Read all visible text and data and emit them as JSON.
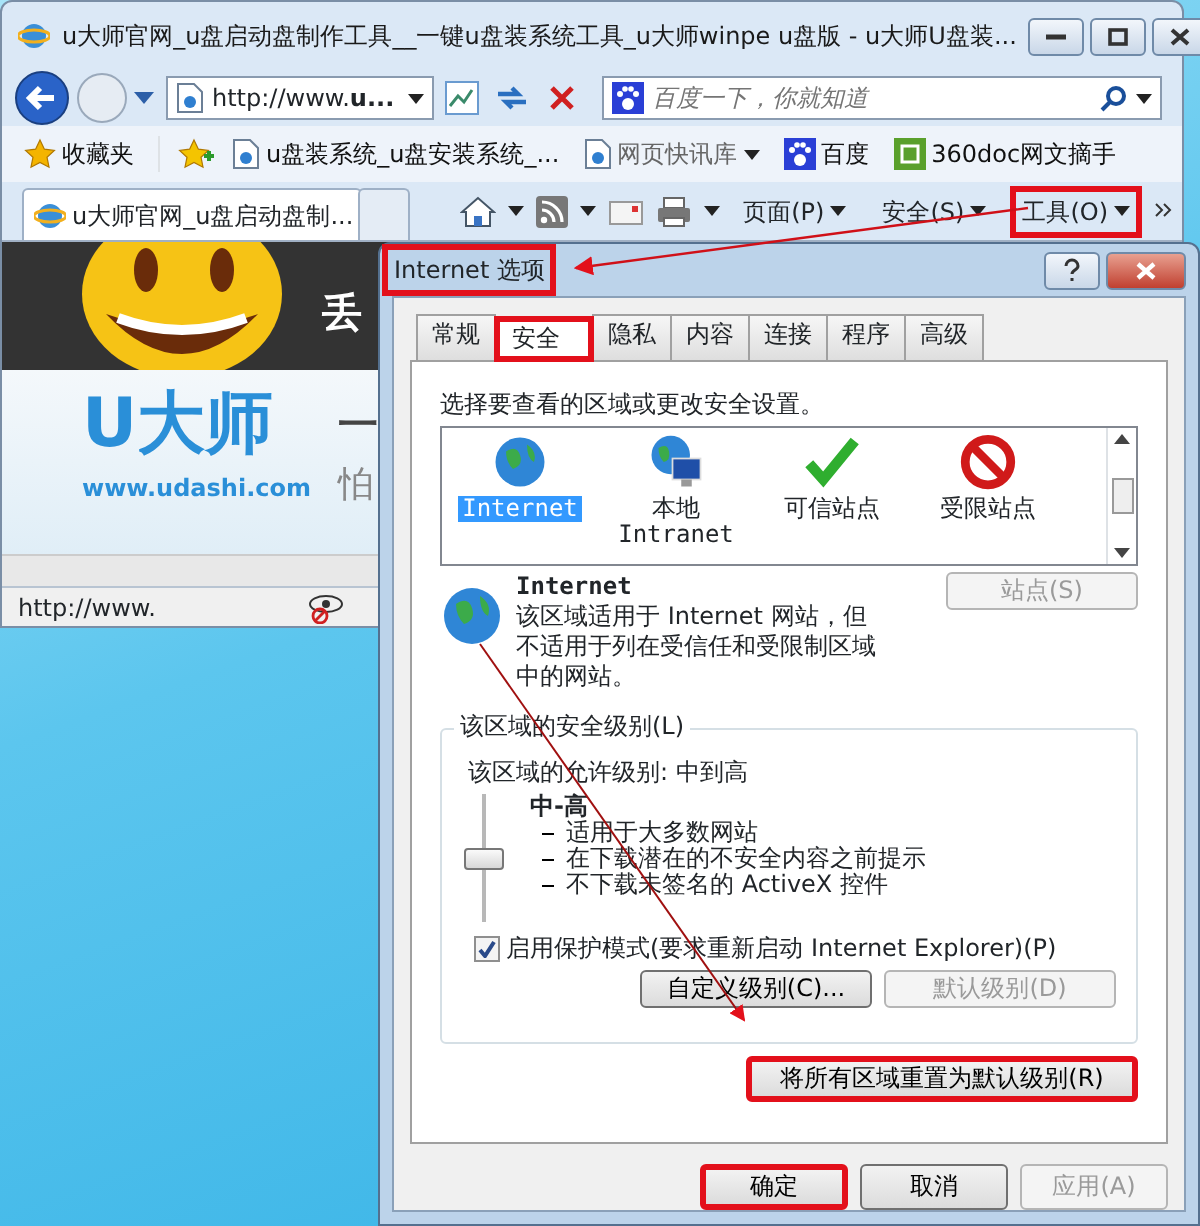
{
  "browser": {
    "title": "u大师官网_u盘启动盘制作工具__一键u盘装系统工具_u大师winpe u盘版 - u大师U盘装...",
    "address": {
      "value": "http://www.**u...**"
    },
    "search": {
      "placeholder": "百度一下，你就知道"
    },
    "favorites": [
      {
        "label": "收藏夹",
        "kind": "favorites"
      },
      {
        "label": "u盘装系统_u盘安装系统_...",
        "kind": "page"
      },
      {
        "label": "网页快讯库",
        "kind": "feed"
      },
      {
        "label": "百度",
        "kind": "paw"
      },
      {
        "label": "360doc网文摘手",
        "kind": "app"
      }
    ],
    "tabs": [
      {
        "label": "u大师官网_u盘启动盘制...",
        "selected": true
      }
    ],
    "commands": [
      {
        "label": "页面(P)",
        "highlighted": false
      },
      {
        "label": "安全(S)",
        "highlighted": false
      },
      {
        "label": "工具(O)",
        "highlighted": true
      }
    ],
    "page": {
      "banner_text": "丢",
      "logo_text": "U大师",
      "logo_url": "www.udashi.com",
      "side_text_1": "一",
      "side_text_2": "怕"
    },
    "status_text": "http://www."
  },
  "dialog": {
    "title": {
      "text": "Internet 选项",
      "highlighted": true
    },
    "tabs": [
      {
        "label": "常规",
        "selected": false,
        "highlighted": false
      },
      {
        "label": "安全",
        "selected": true,
        "highlighted": true
      },
      {
        "label": "隐私",
        "selected": false,
        "highlighted": false
      },
      {
        "label": "内容",
        "selected": false,
        "highlighted": false
      },
      {
        "label": "连接",
        "selected": false,
        "highlighted": false
      },
      {
        "label": "程序",
        "selected": false,
        "highlighted": false
      },
      {
        "label": "高级",
        "selected": false,
        "highlighted": false
      }
    ],
    "prompt": "选择要查看的区域或更改安全设置。",
    "zones": [
      {
        "label": "Internet",
        "kind": "internet",
        "selected": true
      },
      {
        "label": "本地",
        "label_2": "Intranet",
        "kind": "intranet",
        "selected": false
      },
      {
        "label": "可信站点",
        "kind": "trusted",
        "selected": false
      },
      {
        "label": "受限站点",
        "kind": "restricted",
        "selected": false
      }
    ],
    "zone_name": "Internet",
    "zone_description": "该区域适用于 Internet 网站，但不适用于列在受信任和受限制区域中的网站。",
    "sites_button": {
      "label": "站点(S)",
      "disabled": true
    },
    "security": {
      "legend": "该区域的安全级别(L)",
      "allowed": "该区域的允许级别: 中到高",
      "level": 0.5,
      "level_name": "中-高",
      "bullets": [
        "适用于大多数网站",
        "在下载潜在的不安全内容之前提示",
        "不下载未签名的 ActiveX 控件"
      ],
      "protected_mode": {
        "label": "启用保护模式(要求重新启动 Internet Explorer)(P)",
        "checked": true
      },
      "buttons": [
        {
          "label": "自定义级别(C)...",
          "disabled": false
        },
        {
          "label": "默认级别(D)",
          "disabled": true
        }
      ]
    },
    "reset_button": {
      "label": "将所有区域重置为默认级别(R)",
      "highlighted": true
    },
    "buttons": [
      {
        "label": "确定",
        "disabled": false,
        "highlighted": true
      },
      {
        "label": "取消",
        "disabled": false,
        "highlighted": false
      },
      {
        "label": "应用(A)",
        "disabled": true,
        "highlighted": false
      }
    ]
  }
}
